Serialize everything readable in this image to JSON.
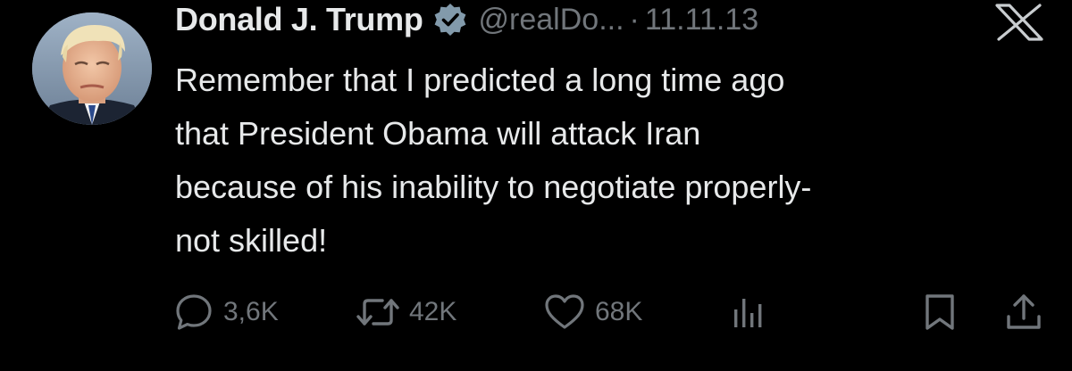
{
  "author": {
    "display_name": "Donald J. Trump",
    "handle": "@realDo...",
    "verified_icon": "verified-badge-icon",
    "avatar": "profile-photo"
  },
  "meta": {
    "separator": "·",
    "date": "11.11.13"
  },
  "brand": {
    "logo_icon": "x-logo-icon"
  },
  "tweet": {
    "lines": [
      "Remember that I predicted a long time ago",
      "that President Obama will attack Iran",
      "because of his inability to negotiate properly-",
      "not skilled!"
    ]
  },
  "actions": {
    "reply": {
      "icon": "reply-icon",
      "count": "3,6K"
    },
    "retweet": {
      "icon": "retweet-icon",
      "count": "42K"
    },
    "like": {
      "icon": "heart-icon",
      "count": "68K"
    },
    "views": {
      "icon": "views-icon"
    },
    "bookmark": {
      "icon": "bookmark-icon"
    },
    "share": {
      "icon": "share-icon"
    }
  },
  "colors": {
    "background": "#000000",
    "primary_text": "#e7e9ea",
    "secondary_text": "#71767b",
    "verified_badge": "#829aab"
  }
}
